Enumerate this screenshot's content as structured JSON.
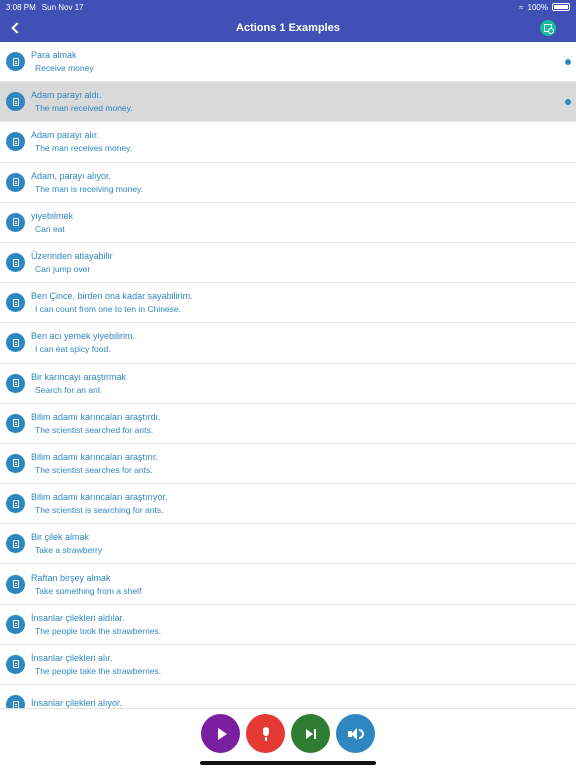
{
  "status_bar": {
    "time": "3:08 PM",
    "date": "Sun Nov 17",
    "battery": "100%"
  },
  "nav": {
    "title": "Actions 1 Examples",
    "back_icon": "chevron-left-icon",
    "save_icon": "save-icon"
  },
  "rows": [
    {
      "title": "Para almak",
      "subtitle": "Receive money"
    },
    {
      "title": "Adam parayı aldı.",
      "subtitle": "The man received money."
    },
    {
      "title": "Adam parayı alır.",
      "subtitle": "The man receives money."
    },
    {
      "title": "Adam, parayı alıyor.",
      "subtitle": "The man is receiving money."
    },
    {
      "title": "yiyebilmek",
      "subtitle": "Can eat"
    },
    {
      "title": "Üzerinden atlayabilir",
      "subtitle": "Can jump over"
    },
    {
      "title": "Ben Çince, birden ona kadar sayabilirim.",
      "subtitle": "I can count from one to ten in Chinese."
    },
    {
      "title": "Ben acı yemek yiyebilirim.",
      "subtitle": "I can eat spicy food."
    },
    {
      "title": "Bir karıncayı araştırmak",
      "subtitle": "Search for an ant"
    },
    {
      "title": "Bilim adamı karıncaları araştırdı.",
      "subtitle": "The scientist searched for ants."
    },
    {
      "title": "Bilim adamı karıncaları araştırır.",
      "subtitle": "The scientist searches for ants."
    },
    {
      "title": "Bilim adamı karıncaları araştırıyor.",
      "subtitle": "The scientist is searching for ants."
    },
    {
      "title": "Bir çilek almak",
      "subtitle": "Take a strawberry"
    },
    {
      "title": "Raftan birşey almak",
      "subtitle": "Take something from a shelf"
    },
    {
      "title": "İnsanlar çilekleri aldılar.",
      "subtitle": "The people took the strawberries."
    },
    {
      "title": "İnsanlar çilekleri alır.",
      "subtitle": "The people take the strawberries."
    },
    {
      "title": "İnsanlar çilekleri alıyor.",
      "subtitle": ""
    }
  ],
  "controls": [
    {
      "name": "play-button",
      "icon": "play-icon",
      "color": "#7b1fa2"
    },
    {
      "name": "microphone-button",
      "icon": "microphone-icon",
      "color": "#e53935"
    },
    {
      "name": "next-button",
      "icon": "skip-next-icon",
      "color": "#2e7d32"
    },
    {
      "name": "speaker-button",
      "icon": "speaker-icon",
      "color": "#2f87c2"
    }
  ],
  "colors": {
    "header": "#3f51b5",
    "accent": "#2f87c2",
    "selected_row": "#d9d9d9"
  }
}
